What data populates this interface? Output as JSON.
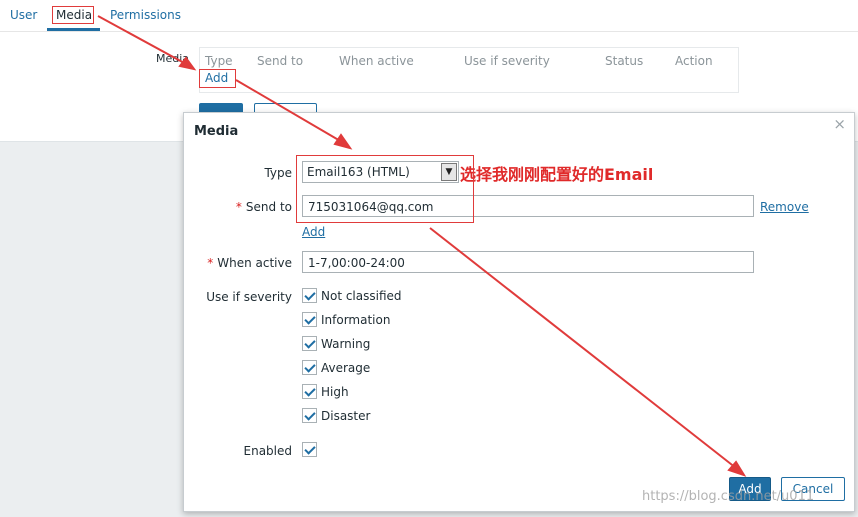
{
  "tabs": {
    "user": "User",
    "media": "Media",
    "permissions": "Permissions"
  },
  "media_list": {
    "label": "Media",
    "columns": [
      "Type",
      "Send to",
      "When active",
      "Use if severity",
      "Status",
      "Action"
    ],
    "add_link": "Add"
  },
  "modal": {
    "title": "Media",
    "close": "×",
    "type_label": "Type",
    "type_value": "Email163 (HTML)",
    "annotation": "选择我刚刚配置好的Email",
    "sendto_label": "Send to",
    "sendto_value": "715031064@qq.com",
    "remove_link": "Remove",
    "add_sendto_link": "Add",
    "when_active_label": "When active",
    "when_active_value": "1-7,00:00-24:00",
    "severity_label": "Use if severity",
    "severities": [
      "Not classified",
      "Information",
      "Warning",
      "Average",
      "High",
      "Disaster"
    ],
    "enabled_label": "Enabled",
    "add_button": "Add",
    "cancel_button": "Cancel",
    "required_mark": "*"
  },
  "watermark": "https://blog.csdn.net/u011"
}
